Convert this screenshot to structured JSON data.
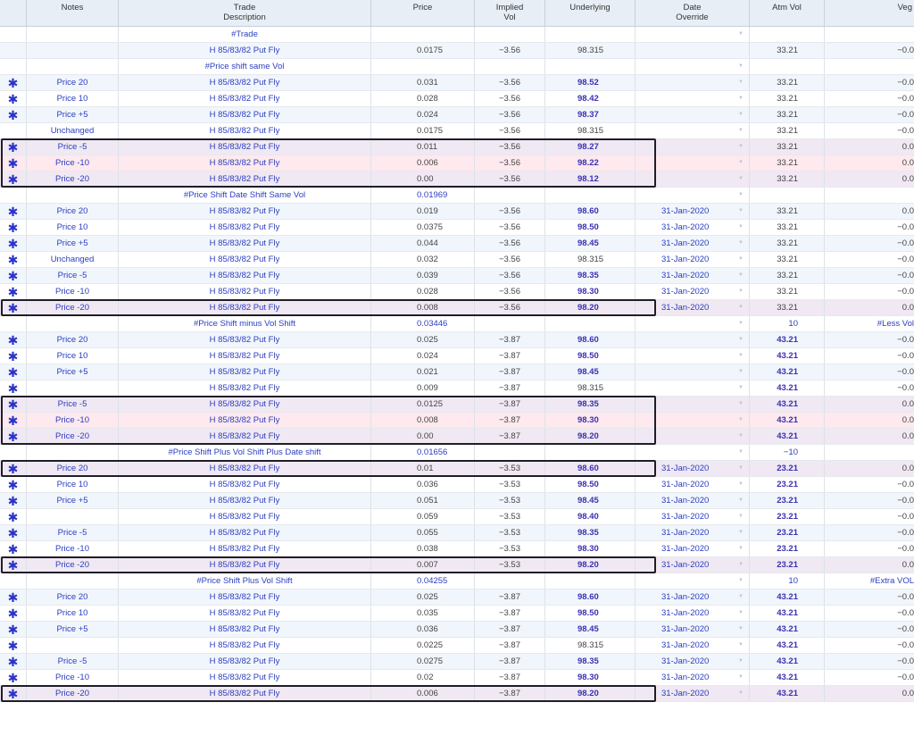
{
  "headers": {
    "notes": "Notes",
    "trade_line1": "Trade",
    "trade_line2": "Description",
    "price": "Price",
    "ivol_line1": "Implied",
    "ivol_line2": "Vol",
    "underlying": "Underlying",
    "date_line1": "Date",
    "date_line2": "Override",
    "atm": "Atm Vol",
    "vega": "Veg"
  },
  "star_symbol": "✱",
  "rows": [
    {
      "star": false,
      "bg": "white",
      "notes": "",
      "desc": "#Trade",
      "price": "",
      "ivol": "",
      "und": "",
      "date": "",
      "caret": true,
      "atm": "",
      "vega": ""
    },
    {
      "star": false,
      "bg": "alt",
      "notes": "",
      "desc": "H 85/83/82 Put Fly",
      "price": "0.0175",
      "ivol": "−3.56",
      "und": "98.315",
      "date": "",
      "caret": false,
      "atm": "33.21",
      "vega": "−0.0"
    },
    {
      "star": false,
      "bg": "white",
      "notes": "",
      "desc": "#Price shift same Vol",
      "price": "",
      "ivol": "",
      "und": "",
      "date": "",
      "caret": true,
      "atm": "",
      "vega": ""
    },
    {
      "star": true,
      "bg": "alt",
      "notes": "Price 20",
      "desc": "H 85/83/82 Put Fly",
      "price": "0.031",
      "ivol": "−3.56",
      "und": "98.52",
      "undBold": true,
      "date": "",
      "caret": true,
      "atm": "33.21",
      "vega": "−0.0"
    },
    {
      "star": true,
      "bg": "white",
      "notes": "Price 10",
      "desc": "H 85/83/82 Put Fly",
      "price": "0.028",
      "ivol": "−3.56",
      "und": "98.42",
      "undBold": true,
      "date": "",
      "caret": true,
      "atm": "33.21",
      "vega": "−0.0"
    },
    {
      "star": true,
      "bg": "alt",
      "notes": "Price +5",
      "desc": "H 85/83/82 Put Fly",
      "price": "0.024",
      "ivol": "−3.56",
      "und": "98.37",
      "undBold": true,
      "date": "",
      "caret": true,
      "atm": "33.21",
      "vega": "−0.0"
    },
    {
      "star": false,
      "bg": "white",
      "notes": "Unchanged",
      "desc": "H 85/83/82 Put Fly",
      "price": "0.0175",
      "ivol": "−3.56",
      "und": "98.315",
      "date": "",
      "caret": true,
      "atm": "33.21",
      "vega": "−0.0"
    },
    {
      "star": true,
      "bg": "lav",
      "notes": "Price -5",
      "desc": "H 85/83/82 Put Fly",
      "price": "0.011",
      "ivol": "−3.56",
      "und": "98.27",
      "undBold": true,
      "date": "",
      "caret": true,
      "atm": "33.21",
      "vega": "0.0"
    },
    {
      "star": true,
      "bg": "pink",
      "notes": "Price -10",
      "desc": "H 85/83/82 Put Fly",
      "price": "0.006",
      "ivol": "−3.56",
      "und": "98.22",
      "undBold": true,
      "date": "",
      "caret": true,
      "atm": "33.21",
      "vega": "0.0"
    },
    {
      "star": true,
      "bg": "lav",
      "notes": "Price -20",
      "desc": "H 85/83/82 Put Fly",
      "price": "0.00",
      "ivol": "−3.56",
      "und": "98.12",
      "undBold": true,
      "date": "",
      "caret": true,
      "atm": "33.21",
      "vega": "0.0"
    },
    {
      "star": false,
      "bg": "white",
      "notes": "",
      "desc": "#Price Shift Date Shift Same Vol",
      "price": "0.01969",
      "priceBlue": true,
      "ivol": "",
      "und": "",
      "date": "",
      "caret": true,
      "atm": "",
      "vega": ""
    },
    {
      "star": true,
      "bg": "alt",
      "notes": "Price 20",
      "desc": "H 85/83/82 Put Fly",
      "price": "0.019",
      "ivol": "−3.56",
      "und": "98.60",
      "undBold": true,
      "date": "31-Jan-2020",
      "caret": true,
      "atm": "33.21",
      "vega": "0.0"
    },
    {
      "star": true,
      "bg": "white",
      "notes": "Price 10",
      "desc": "H 85/83/82 Put Fly",
      "price": "0.0375",
      "ivol": "−3.56",
      "und": "98.50",
      "undBold": true,
      "date": "31-Jan-2020",
      "caret": true,
      "atm": "33.21",
      "vega": "−0.0"
    },
    {
      "star": true,
      "bg": "alt",
      "notes": "Price +5",
      "desc": "H 85/83/82 Put Fly",
      "price": "0.044",
      "ivol": "−3.56",
      "und": "98.45",
      "undBold": true,
      "date": "31-Jan-2020",
      "caret": true,
      "atm": "33.21",
      "vega": "−0.0"
    },
    {
      "star": true,
      "bg": "white",
      "notes": "Unchanged",
      "desc": "H 85/83/82 Put Fly",
      "price": "0.032",
      "ivol": "−3.56",
      "und": "98.315",
      "date": "31-Jan-2020",
      "caret": true,
      "atm": "33.21",
      "vega": "−0.0"
    },
    {
      "star": true,
      "bg": "alt",
      "notes": "Price -5",
      "desc": "H 85/83/82 Put Fly",
      "price": "0.039",
      "ivol": "−3.56",
      "und": "98.35",
      "undBold": true,
      "date": "31-Jan-2020",
      "caret": true,
      "atm": "33.21",
      "vega": "−0.0"
    },
    {
      "star": true,
      "bg": "white",
      "notes": "Price -10",
      "desc": "H 85/83/82 Put Fly",
      "price": "0.028",
      "ivol": "−3.56",
      "und": "98.30",
      "undBold": true,
      "date": "31-Jan-2020",
      "caret": true,
      "atm": "33.21",
      "vega": "−0.0"
    },
    {
      "star": true,
      "bg": "lav",
      "notes": "Price -20",
      "desc": "H 85/83/82 Put Fly",
      "price": "0.008",
      "ivol": "−3.56",
      "und": "98.20",
      "undBold": true,
      "date": "31-Jan-2020",
      "caret": true,
      "atm": "33.21",
      "vega": "0.0"
    },
    {
      "star": false,
      "bg": "white",
      "notes": "",
      "desc": "#Price Shift minus Vol Shift",
      "price": "0.03446",
      "priceBlue": true,
      "ivol": "",
      "und": "",
      "date": "",
      "caret": true,
      "atm": "10",
      "atmBlue": true,
      "vega": "#Less Vol",
      "vegaBlue": true
    },
    {
      "star": true,
      "bg": "alt",
      "notes": "Price 20",
      "desc": "H 85/83/82 Put Fly",
      "price": "0.025",
      "ivol": "−3.87",
      "und": "98.60",
      "undBold": true,
      "date": "",
      "caret": true,
      "atm": "43.21",
      "atmBold": true,
      "vega": "−0.0"
    },
    {
      "star": true,
      "bg": "white",
      "notes": "Price 10",
      "desc": "H 85/83/82 Put Fly",
      "price": "0.024",
      "ivol": "−3.87",
      "und": "98.50",
      "undBold": true,
      "date": "",
      "caret": true,
      "atm": "43.21",
      "atmBold": true,
      "vega": "−0.0"
    },
    {
      "star": true,
      "bg": "alt",
      "notes": "Price +5",
      "desc": "H 85/83/82 Put Fly",
      "price": "0.021",
      "ivol": "−3.87",
      "und": "98.45",
      "undBold": true,
      "date": "",
      "caret": true,
      "atm": "43.21",
      "atmBold": true,
      "vega": "−0.0"
    },
    {
      "star": true,
      "bg": "white",
      "notes": "",
      "desc": "H 85/83/82 Put Fly",
      "price": "0.009",
      "ivol": "−3.87",
      "und": "98.315",
      "date": "",
      "caret": true,
      "atm": "43.21",
      "atmBold": true,
      "vega": "−0.0"
    },
    {
      "star": true,
      "bg": "lav",
      "notes": "Price -5",
      "desc": "H 85/83/82 Put Fly",
      "price": "0.0125",
      "ivol": "−3.87",
      "und": "98.35",
      "undBold": true,
      "date": "",
      "caret": true,
      "atm": "43.21",
      "atmBold": true,
      "vega": "0.0"
    },
    {
      "star": true,
      "bg": "pink",
      "notes": "Price -10",
      "desc": "H 85/83/82 Put Fly",
      "price": "0.008",
      "ivol": "−3.87",
      "und": "98.30",
      "undBold": true,
      "date": "",
      "caret": true,
      "atm": "43.21",
      "atmBold": true,
      "vega": "0.0"
    },
    {
      "star": true,
      "bg": "lav",
      "notes": "Price -20",
      "desc": "H 85/83/82 Put Fly",
      "price": "0.00",
      "ivol": "−3.87",
      "und": "98.20",
      "undBold": true,
      "date": "",
      "caret": true,
      "atm": "43.21",
      "atmBold": true,
      "vega": "0.0"
    },
    {
      "star": false,
      "bg": "white",
      "notes": "",
      "desc": "#Price Shift Plus Vol Shift Plus Date shift",
      "price": "0.01656",
      "priceBlue": true,
      "ivol": "",
      "und": "",
      "date": "",
      "caret": true,
      "atm": "−10",
      "atmBlue": true,
      "vega": ""
    },
    {
      "star": true,
      "bg": "lav",
      "notes": "Price 20",
      "desc": "H 85/83/82 Put Fly",
      "price": "0.01",
      "ivol": "−3.53",
      "und": "98.60",
      "undBold": true,
      "date": "31-Jan-2020",
      "caret": true,
      "atm": "23.21",
      "atmBold": true,
      "vega": "0.0"
    },
    {
      "star": true,
      "bg": "white",
      "notes": "Price 10",
      "desc": "H 85/83/82 Put Fly",
      "price": "0.036",
      "ivol": "−3.53",
      "und": "98.50",
      "undBold": true,
      "date": "31-Jan-2020",
      "caret": true,
      "atm": "23.21",
      "atmBold": true,
      "vega": "−0.0"
    },
    {
      "star": true,
      "bg": "alt",
      "notes": "Price +5",
      "desc": "H 85/83/82 Put Fly",
      "price": "0.051",
      "ivol": "−3.53",
      "und": "98.45",
      "undBold": true,
      "date": "31-Jan-2020",
      "caret": true,
      "atm": "23.21",
      "atmBold": true,
      "vega": "−0.0"
    },
    {
      "star": true,
      "bg": "white",
      "notes": "",
      "desc": "H 85/83/82 Put Fly",
      "price": "0.059",
      "ivol": "−3.53",
      "und": "98.40",
      "undBold": true,
      "date": "31-Jan-2020",
      "caret": true,
      "atm": "23.21",
      "atmBold": true,
      "vega": "−0.0"
    },
    {
      "star": true,
      "bg": "alt",
      "notes": "Price -5",
      "desc": "H 85/83/82 Put Fly",
      "price": "0.055",
      "ivol": "−3.53",
      "und": "98.35",
      "undBold": true,
      "date": "31-Jan-2020",
      "caret": true,
      "atm": "23.21",
      "atmBold": true,
      "vega": "−0.0"
    },
    {
      "star": true,
      "bg": "white",
      "notes": "Price -10",
      "desc": "H 85/83/82 Put Fly",
      "price": "0.038",
      "ivol": "−3.53",
      "und": "98.30",
      "undBold": true,
      "date": "31-Jan-2020",
      "caret": true,
      "atm": "23.21",
      "atmBold": true,
      "vega": "−0.0"
    },
    {
      "star": true,
      "bg": "lav",
      "notes": "Price -20",
      "desc": "H 85/83/82 Put Fly",
      "price": "0.007",
      "ivol": "−3.53",
      "und": "98.20",
      "undBold": true,
      "date": "31-Jan-2020",
      "caret": true,
      "atm": "23.21",
      "atmBold": true,
      "vega": "0.0"
    },
    {
      "star": false,
      "bg": "white",
      "notes": "",
      "desc": "#Price Shift Plus Vol Shift",
      "price": "0.04255",
      "priceBlue": true,
      "ivol": "",
      "und": "",
      "date": "",
      "caret": true,
      "atm": "10",
      "atmBlue": true,
      "vega": "#Extra VOL",
      "vegaBlue": true
    },
    {
      "star": true,
      "bg": "alt",
      "notes": "Price 20",
      "desc": "H 85/83/82 Put Fly",
      "price": "0.025",
      "ivol": "−3.87",
      "und": "98.60",
      "undBold": true,
      "date": "31-Jan-2020",
      "caret": true,
      "atm": "43.21",
      "atmBold": true,
      "vega": "−0.0"
    },
    {
      "star": true,
      "bg": "white",
      "notes": "Price 10",
      "desc": "H 85/83/82 Put Fly",
      "price": "0.035",
      "ivol": "−3.87",
      "und": "98.50",
      "undBold": true,
      "date": "31-Jan-2020",
      "caret": true,
      "atm": "43.21",
      "atmBold": true,
      "vega": "−0.0"
    },
    {
      "star": true,
      "bg": "alt",
      "notes": "Price +5",
      "desc": "H 85/83/82 Put Fly",
      "price": "0.036",
      "ivol": "−3.87",
      "und": "98.45",
      "undBold": true,
      "date": "31-Jan-2020",
      "caret": true,
      "atm": "43.21",
      "atmBold": true,
      "vega": "−0.0"
    },
    {
      "star": true,
      "bg": "white",
      "notes": "",
      "desc": "H 85/83/82 Put Fly",
      "price": "0.0225",
      "ivol": "−3.87",
      "und": "98.315",
      "date": "31-Jan-2020",
      "caret": true,
      "atm": "43.21",
      "atmBold": true,
      "vega": "−0.0"
    },
    {
      "star": true,
      "bg": "alt",
      "notes": "Price -5",
      "desc": "H 85/83/82 Put Fly",
      "price": "0.0275",
      "ivol": "−3.87",
      "und": "98.35",
      "undBold": true,
      "date": "31-Jan-2020",
      "caret": true,
      "atm": "43.21",
      "atmBold": true,
      "vega": "−0.0"
    },
    {
      "star": true,
      "bg": "white",
      "notes": "Price -10",
      "desc": "H 85/83/82 Put Fly",
      "price": "0.02",
      "ivol": "−3.87",
      "und": "98.30",
      "undBold": true,
      "date": "31-Jan-2020",
      "caret": true,
      "atm": "43.21",
      "atmBold": true,
      "vega": "−0.0"
    },
    {
      "star": true,
      "bg": "lav",
      "notes": "Price -20",
      "desc": "H 85/83/82 Put Fly",
      "price": "0.006",
      "ivol": "−3.87",
      "und": "98.20",
      "undBold": true,
      "date": "31-Jan-2020",
      "caret": true,
      "atm": "43.21",
      "atmBold": true,
      "vega": "0.0"
    }
  ],
  "highlight_groups": [
    {
      "start": 7,
      "count": 3
    },
    {
      "start": 17,
      "count": 1
    },
    {
      "start": 23,
      "count": 3
    },
    {
      "start": 27,
      "count": 1
    },
    {
      "start": 33,
      "count": 1
    },
    {
      "start": 41,
      "count": 1
    }
  ]
}
